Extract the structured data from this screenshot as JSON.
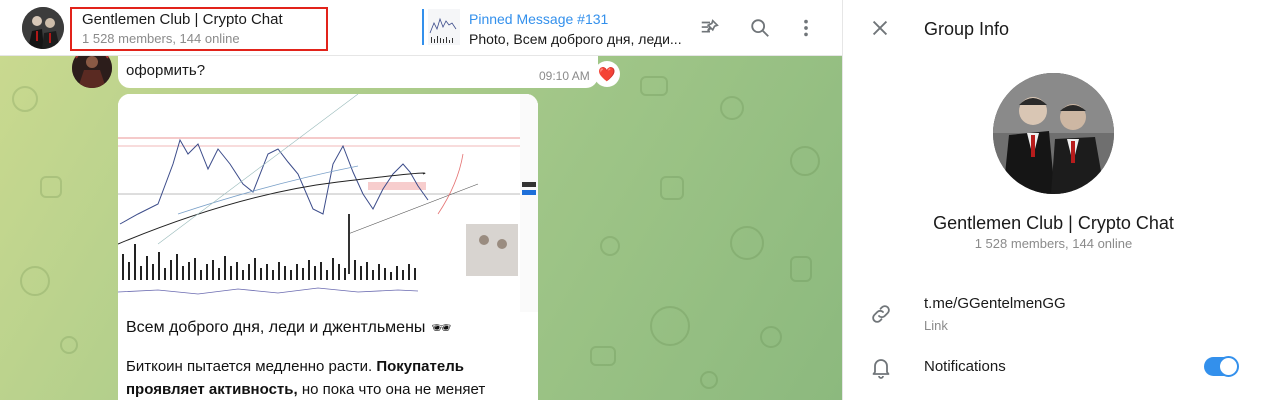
{
  "chat": {
    "title": "Gentlemen Club | Crypto Chat",
    "subtitle": "1 528 members, 144 online",
    "pinned": {
      "title": "Pinned Message #131",
      "text": "Photo, Всем доброго дня, леди..."
    },
    "icons": [
      "pin-list-icon",
      "search-icon",
      "more-vertical-icon"
    ]
  },
  "messages": {
    "first": {
      "text": "оформить?",
      "time": "09:10 AM",
      "reaction": "❤️"
    },
    "post": {
      "line1": "Всем доброго дня, леди и джентльмены",
      "line1_emoji": "🕶",
      "line2_normal": "Биткоин пытается медленно расти. ",
      "line2_bold": "Покупатель",
      "line3_bold": "проявляет активность,",
      "line3_normal": " но пока что она не меняет"
    }
  },
  "panel": {
    "title": "Group Info",
    "group_name": "Gentlemen Club | Crypto Chat",
    "group_sub": "1 528 members, 144 online",
    "link": "t.me/GGentelmenGG",
    "link_label": "Link",
    "notifications": "Notifications",
    "notifications_on": true
  },
  "colors": {
    "accent": "#3390ec",
    "highlight_box": "#e2231a",
    "chat_bg": "#a8c98a"
  }
}
